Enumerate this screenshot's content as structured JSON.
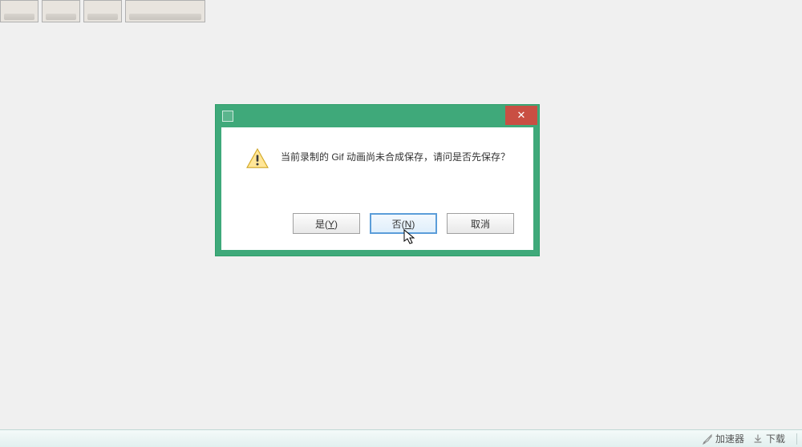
{
  "dialog": {
    "message": "当前录制的 Gif 动画尚未合成保存，请问是否先保存？",
    "buttons": {
      "yes": "是(Y)",
      "no": "否(N)",
      "cancel": "取消"
    }
  },
  "taskbar": {
    "accelerator": "加速器",
    "download": "下载"
  }
}
